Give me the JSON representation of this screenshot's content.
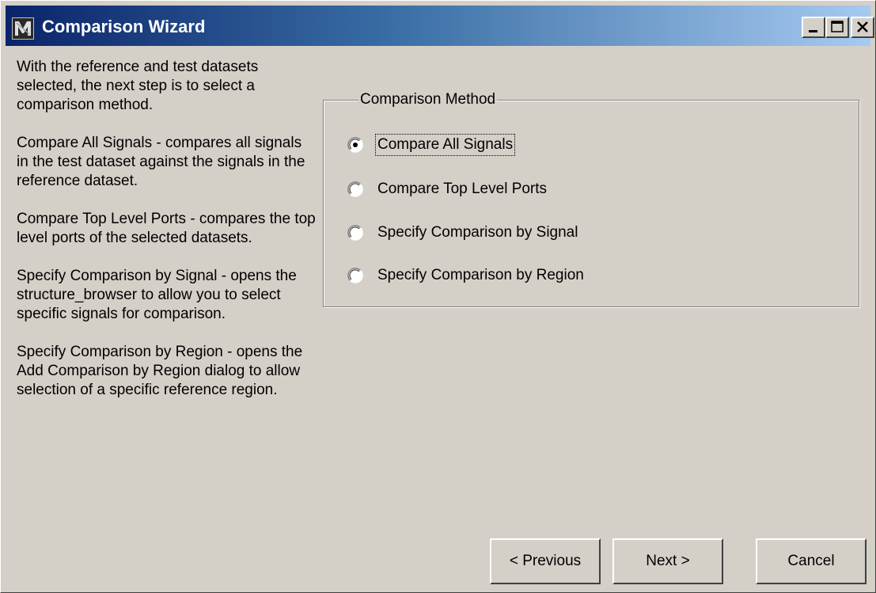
{
  "window": {
    "title": "Comparison Wizard",
    "app_icon": "modelsim-app-icon",
    "caption_buttons": {
      "minimize_icon": "minimize-icon",
      "maximize_icon": "maximize-icon",
      "close_icon": "close-icon"
    }
  },
  "description": {
    "paragraphs": [
      "With the reference and test datasets selected, the next step is to select a comparison method.",
      "Compare All Signals - compares all signals in the test dataset against the signals in the reference dataset.",
      "Compare Top Level Ports - compares the top level ports of the selected datasets.",
      "Specify Comparison by Signal - opens the structure_browser to allow you to select specific signals for comparison.",
      "Specify Comparison by Region - opens the Add Comparison by Region dialog to allow selection of a specific reference region."
    ]
  },
  "comparison_method": {
    "legend": "Comparison Method",
    "options": [
      {
        "label": "Compare All Signals",
        "selected": true
      },
      {
        "label": "Compare Top Level Ports",
        "selected": false
      },
      {
        "label": "Specify Comparison by Signal",
        "selected": false
      },
      {
        "label": "Specify Comparison by Region",
        "selected": false
      }
    ]
  },
  "buttons": {
    "previous": "< Previous",
    "next": "Next >",
    "cancel": "Cancel"
  },
  "colors": {
    "window_bg": "#d4d0c8",
    "titlebar_start": "#0a246a",
    "titlebar_end": "#a6caf0",
    "title_text": "#ffffff"
  }
}
